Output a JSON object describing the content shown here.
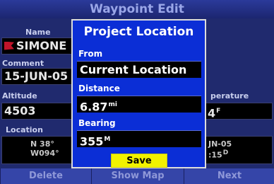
{
  "window": {
    "title": "Waypoint Edit"
  },
  "waypoint": {
    "name_label": "Name",
    "name_value": "SIMONE",
    "comment_label": "Comment",
    "comment_value": "15-JUN-05",
    "altitude_label": "Altitude",
    "altitude_value": "4503",
    "temperature_label": "perature",
    "temperature_value": "4",
    "temperature_unit": "F",
    "location_label": "Location",
    "location_line1": "N  38°",
    "location_line2": "W094°",
    "date_line1": "JN-05",
    "date_line2": ":15",
    "date_suffix": "D"
  },
  "dialog": {
    "title": "Project Location",
    "from_label": "From",
    "from_value": "Current Location",
    "distance_label": "Distance",
    "distance_value": "6.87",
    "distance_unit": "mi",
    "bearing_label": "Bearing",
    "bearing_value": "355",
    "bearing_unit": "M",
    "save_label": "Save"
  },
  "bottom": {
    "delete_label": "Delete",
    "show_map_label": "Show Map",
    "next_label": "Next"
  },
  "colors": {
    "dialog_bg": "#0b2ed6",
    "save_btn": "#f2f200",
    "flag": "#c0142a"
  }
}
